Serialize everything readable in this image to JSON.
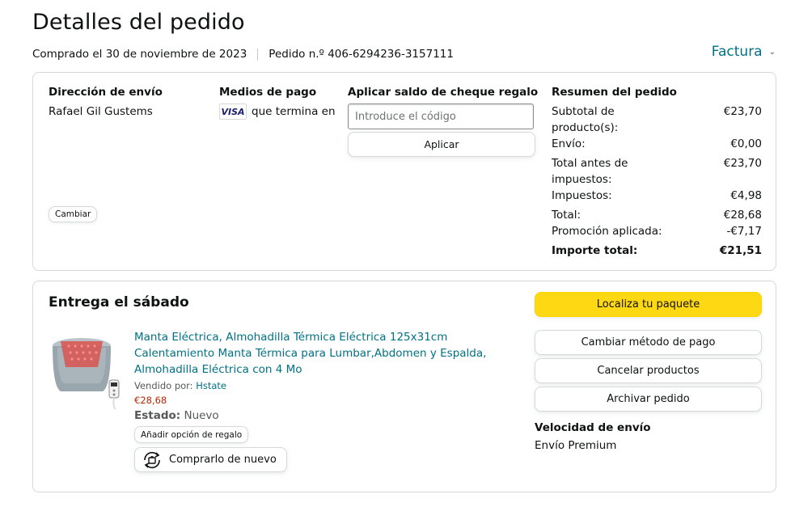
{
  "header": {
    "title": "Detalles del pedido",
    "ordered": "Comprado el 30 de noviembre de 2023",
    "order_number": "Pedido n.º 406-6294236-3157111",
    "invoice": "Factura"
  },
  "summary_card": {
    "shipping": {
      "heading": "Dirección de envío",
      "name": "Rafael Gil Gustems",
      "change_button": "Cambiar"
    },
    "payment": {
      "heading": "Medios de pago",
      "card_brand": "VISA",
      "card_text": "que termina en"
    },
    "gift": {
      "heading": "Aplicar saldo de cheque regalo",
      "placeholder": "Introduce el código",
      "apply_button": "Aplicar"
    },
    "order_summary": {
      "heading": "Resumen del pedido",
      "rows": [
        {
          "label": "Subtotal de producto(s):",
          "value": "€23,70"
        },
        {
          "label": "Envío:",
          "value": "€0,00"
        },
        {
          "label": "Total antes de impuestos:",
          "value": "€23,70"
        },
        {
          "label": "Impuestos:",
          "value": "€4,98"
        },
        {
          "label": "Total:",
          "value": "€28,68"
        },
        {
          "label": "Promoción aplicada:",
          "value": "-€7,17"
        }
      ],
      "grand_total": {
        "label": "Importe total:",
        "value": "€21,51"
      }
    }
  },
  "delivery_card": {
    "title": "Entrega el sábado",
    "product": {
      "title": "Manta Eléctrica, Almohadilla Térmica Eléctrica 125x31cm Calentamiento Manta Térmica para Lumbar,Abdomen y Espalda, Almohadilla Eléctrica con 4 Mo",
      "sold_by_label": "Vendido por:",
      "seller": "Hstate",
      "price": "€28,68",
      "status_label": "Estado:",
      "status_value": "Nuevo",
      "gift_button": "Añadir opción de regalo",
      "rebuy_button": "Comprarlo de nuevo"
    },
    "actions": {
      "track": "Localiza tu paquete",
      "change_payment": "Cambiar método de pago",
      "cancel": "Cancelar productos",
      "archive": "Archivar pedido"
    },
    "shipping_speed": {
      "heading": "Velocidad de envío",
      "value": "Envío Premium"
    }
  },
  "colors": {
    "link": "#007185",
    "primary_button": "#ffd814",
    "price": "#b12704",
    "border": "#d5d9d9"
  }
}
